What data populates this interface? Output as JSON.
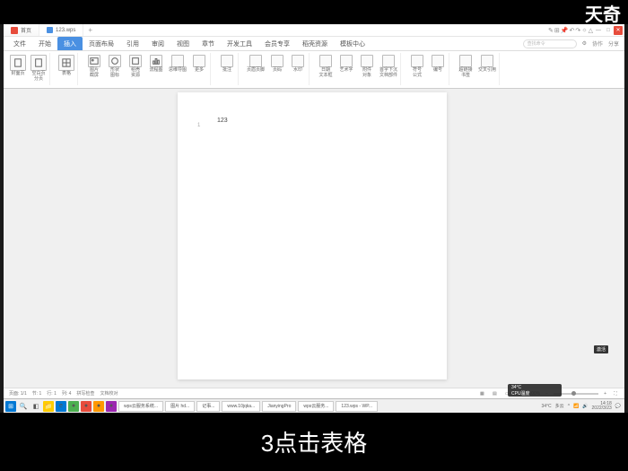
{
  "watermark": "天奇",
  "caption": "3点击表格",
  "tabs": {
    "wps": "WPS",
    "home": "首页",
    "doc": "123.wps",
    "add": "+"
  },
  "window_icons": [
    "☰",
    "⊞",
    "▭",
    "—",
    "□",
    "✕"
  ],
  "menu": {
    "items": [
      "文件",
      "开始",
      "插入",
      "页面布局",
      "引用",
      "审阅",
      "视图",
      "章节",
      "开发工具",
      "会员专享",
      "稻壳资源",
      "模板中心"
    ],
    "active_index": 2,
    "search_placeholder": "查找命令",
    "right": [
      "⚙",
      "协作",
      "分享"
    ]
  },
  "ribbon": [
    {
      "label": "封面页",
      "sub": ""
    },
    {
      "label": "空白页",
      "sub": "分页"
    },
    {
      "label": "表格",
      "sub": ""
    },
    {
      "label": "图片",
      "sub": "截屏"
    },
    {
      "label": "形状",
      "sub": "图标"
    },
    {
      "label": "稻壳",
      "sub": "资源"
    },
    {
      "label": "流程图",
      "sub": ""
    },
    {
      "label": "思维导图",
      "sub": ""
    },
    {
      "label": "更多",
      "sub": ""
    },
    {
      "label": "批注",
      "sub": ""
    },
    {
      "label": "页眉页脚",
      "sub": ""
    },
    {
      "label": "页码",
      "sub": ""
    },
    {
      "label": "水印",
      "sub": ""
    },
    {
      "label": "日期",
      "sub": "文本框"
    },
    {
      "label": "艺术字",
      "sub": ""
    },
    {
      "label": "附件",
      "sub": "对象"
    },
    {
      "label": "首字下沉",
      "sub": "文档部件"
    },
    {
      "label": "符号",
      "sub": "公式"
    },
    {
      "label": "编号",
      "sub": ""
    },
    {
      "label": "超链接",
      "sub": "书签"
    },
    {
      "label": "交叉引用",
      "sub": ""
    }
  ],
  "page": {
    "number": "1",
    "text": "123"
  },
  "status": {
    "left": [
      "页面: 1/1",
      "节: 1",
      "行: 1",
      "列: 4",
      "拼写检查",
      "文档校对"
    ],
    "right_zoom": "100%"
  },
  "taskbar": {
    "apps": [
      "wps云服务系统...",
      "图片 hd...",
      "记事...",
      "www.10jqka...",
      "JianyingPro",
      "wps云服务...",
      "123.wps - WP..."
    ],
    "tray_temp": "34°C",
    "tray_temp_label": "多云",
    "time": "14:18",
    "date": "2022/3/23"
  },
  "widget": {
    "temp": "34°C",
    "cpu": "CPU温度"
  },
  "tooltip": "激活"
}
